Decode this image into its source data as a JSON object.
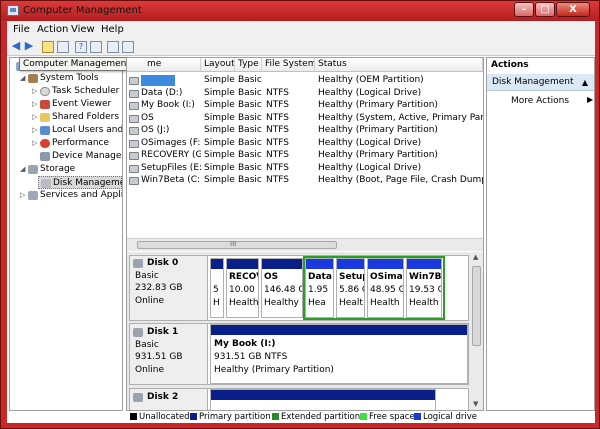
{
  "window": {
    "title": "Computer Management"
  },
  "menu": [
    "File",
    "Action",
    "View",
    "Help"
  ],
  "tooltip": "Computer Management (Local)",
  "tree": [
    {
      "label": "System Tools",
      "level": 1,
      "expander": "◢",
      "icon": "tools-icon"
    },
    {
      "label": "Task Scheduler",
      "level": 2,
      "expander": "▷",
      "icon": "clock-icon"
    },
    {
      "label": "Event Viewer",
      "level": 2,
      "expander": "▷",
      "icon": "event-icon"
    },
    {
      "label": "Shared Folders",
      "level": 2,
      "expander": "▷",
      "icon": "folder-icon"
    },
    {
      "label": "Local Users and Gr",
      "level": 2,
      "expander": "▷",
      "icon": "users-icon"
    },
    {
      "label": "Performance",
      "level": 2,
      "expander": "▷",
      "icon": "performance-icon"
    },
    {
      "label": "Device Manager",
      "level": 2,
      "expander": "",
      "icon": "device-icon"
    },
    {
      "label": "Storage",
      "level": 1,
      "expander": "◢",
      "icon": "storage-icon"
    },
    {
      "label": "Disk Management",
      "level": 2,
      "expander": "",
      "icon": "disk-icon",
      "selected": true
    },
    {
      "label": "Services and Applicat",
      "level": 1,
      "expander": "▷",
      "icon": "services-icon"
    }
  ],
  "volume_table": {
    "headers": [
      "me",
      "Layout",
      "Type",
      "File System",
      "Status"
    ],
    "rows": [
      [
        "",
        "Simple",
        "Basic",
        "",
        "Healthy (OEM Partition)"
      ],
      [
        "Data (D:)",
        "Simple",
        "Basic",
        "NTFS",
        "Healthy (Logical Drive)"
      ],
      [
        "My Book (I:)",
        "Simple",
        "Basic",
        "NTFS",
        "Healthy (Primary Partition)"
      ],
      [
        "OS",
        "Simple",
        "Basic",
        "NTFS",
        "Healthy (System, Active, Primary Partition)"
      ],
      [
        "OS (J:)",
        "Simple",
        "Basic",
        "NTFS",
        "Healthy (Primary Partition)"
      ],
      [
        "OSimages (F:)",
        "Simple",
        "Basic",
        "NTFS",
        "Healthy (Logical Drive)"
      ],
      [
        "RECOVERY (G:)",
        "Simple",
        "Basic",
        "NTFS",
        "Healthy (Primary Partition)"
      ],
      [
        "SetupFiles (E:)",
        "Simple",
        "Basic",
        "NTFS",
        "Healthy (Logical Drive)"
      ],
      [
        "Win7Beta (C:)",
        "Simple",
        "Basic",
        "NTFS",
        "Healthy (Boot, Page File, Crash Dump, Lo"
      ]
    ]
  },
  "disks": [
    {
      "name": "Disk 0",
      "type": "Basic",
      "size": "232.83 GB",
      "state": "Online",
      "partitions": [
        {
          "name": "",
          "size": "5",
          "status": "H"
        },
        {
          "name": "RECOV",
          "size": "10.00 (",
          "status": "Healthy"
        },
        {
          "name": "OS",
          "size": "146.48 G",
          "status": "Healthy ("
        },
        {
          "name": "Data",
          "size": "1.95",
          "status": "Hea"
        },
        {
          "name": "Setup",
          "size": "5.86 G",
          "status": "Healt"
        },
        {
          "name": "OSimag",
          "size": "48.95 GI",
          "status": "Health"
        },
        {
          "name": "Win7B",
          "size": "19.53 C",
          "status": "Health"
        }
      ]
    },
    {
      "name": "Disk 1",
      "type": "Basic",
      "size": "931.51 GB",
      "state": "Online",
      "partitions": [
        {
          "name": "My Book  (I:)",
          "size": "931.51 GB NTFS",
          "status": "Healthy (Primary Partition)"
        }
      ]
    },
    {
      "name": "Disk 2",
      "type": "",
      "size": "",
      "state": "",
      "partitions": []
    }
  ],
  "legend": [
    {
      "label": "Unallocated",
      "color": "#000000"
    },
    {
      "label": "Primary partition",
      "color": "#0a1f8a"
    },
    {
      "label": "Extended partition",
      "color": "#2a8a2a"
    },
    {
      "label": "Free space",
      "color": "#44dd44"
    },
    {
      "label": "Logical drive",
      "color": "#1a3adf"
    }
  ],
  "actions": {
    "header": "Actions",
    "selected": "Disk Management",
    "more": "More Actions"
  },
  "hscroll_glyph": "III",
  "window_buttons": {
    "minimize": "–",
    "maximize": "□",
    "close": "X"
  }
}
